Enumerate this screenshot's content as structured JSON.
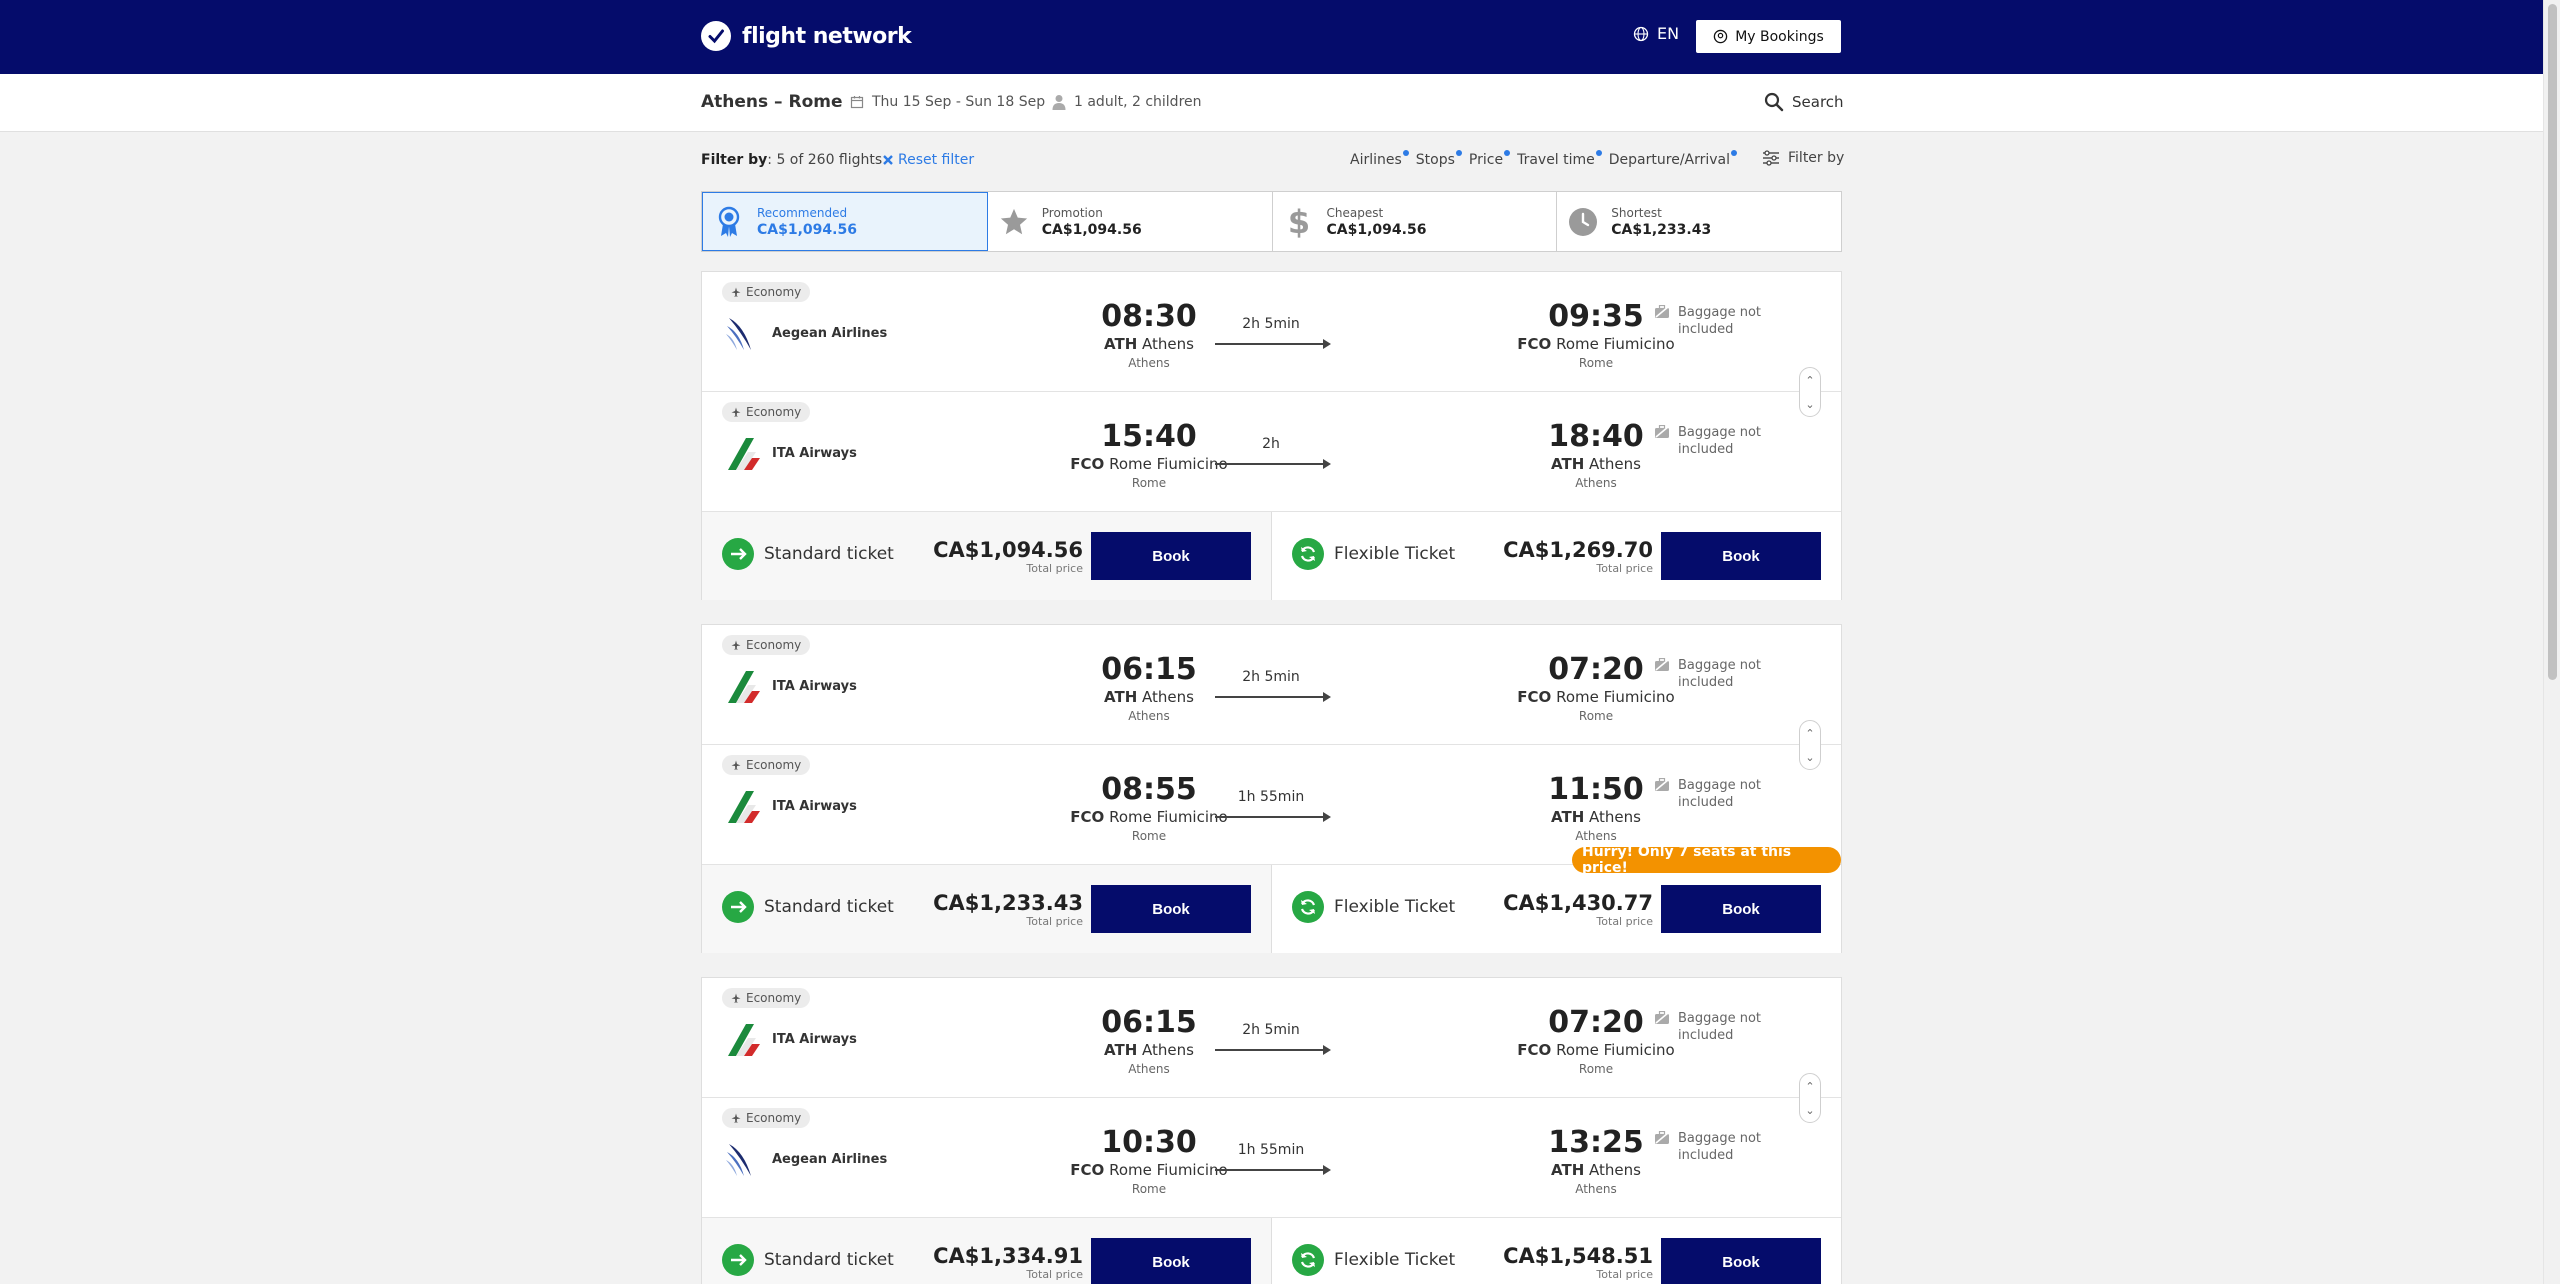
{
  "header": {
    "brand": "flight network",
    "language": "EN",
    "my_bookings": "My Bookings"
  },
  "summary": {
    "route": "Athens – Rome",
    "dates": "Thu 15 Sep - Sun 18 Sep",
    "passengers": "1 adult, 2 children",
    "search": "Search"
  },
  "filters": {
    "label": "Filter by",
    "count": ": 5 of 260 flights",
    "reset": "Reset filter",
    "chips": [
      "Airlines",
      "Stops",
      "Price",
      "Travel time",
      "Departure/Arrival"
    ],
    "filter_by": "Filter by"
  },
  "sort_tabs": [
    {
      "label": "Recommended",
      "price": "CA$1,094.56",
      "icon": "award-icon",
      "active": true
    },
    {
      "label": "Promotion",
      "price": "CA$1,094.56",
      "icon": "star-icon",
      "active": false
    },
    {
      "label": "Cheapest",
      "price": "CA$1,094.56",
      "icon": "dollar-icon",
      "active": false
    },
    {
      "label": "Shortest",
      "price": "CA$1,233.43",
      "icon": "clock-icon",
      "active": false
    }
  ],
  "results": [
    {
      "legs": [
        {
          "cabin": "Economy",
          "airline": "Aegean Airlines",
          "dep_time": "08:30",
          "dep_code": "ATH",
          "dep_airport": "Athens",
          "dep_city": "Athens",
          "duration": "2h 5min",
          "arr_time": "09:35",
          "arr_code": "FCO",
          "arr_airport": "Rome Fiumicino",
          "arr_city": "Rome",
          "baggage": "Baggage not included"
        },
        {
          "cabin": "Economy",
          "airline": "ITA Airways",
          "dep_time": "15:40",
          "dep_code": "FCO",
          "dep_airport": "Rome Fiumicino",
          "dep_city": "Rome",
          "duration": "2h",
          "arr_time": "18:40",
          "arr_code": "ATH",
          "arr_airport": "Athens",
          "arr_city": "Athens",
          "baggage": "Baggage not included"
        }
      ],
      "standard": {
        "name": "Standard ticket",
        "price": "CA$1,094.56",
        "sub": "Total price",
        "book": "Book"
      },
      "flexible": {
        "name": "Flexible Ticket",
        "price": "CA$1,269.70",
        "sub": "Total price",
        "book": "Book"
      }
    },
    {
      "legs": [
        {
          "cabin": "Economy",
          "airline": "ITA Airways",
          "dep_time": "06:15",
          "dep_code": "ATH",
          "dep_airport": "Athens",
          "dep_city": "Athens",
          "duration": "2h 5min",
          "arr_time": "07:20",
          "arr_code": "FCO",
          "arr_airport": "Rome Fiumicino",
          "arr_city": "Rome",
          "baggage": "Baggage not included"
        },
        {
          "cabin": "Economy",
          "airline": "ITA Airways",
          "dep_time": "08:55",
          "dep_code": "FCO",
          "dep_airport": "Rome Fiumicino",
          "dep_city": "Rome",
          "duration": "1h 55min",
          "arr_time": "11:50",
          "arr_code": "ATH",
          "arr_airport": "Athens",
          "arr_city": "Athens",
          "baggage": "Baggage not included"
        }
      ],
      "urgency": "Hurry! Only 7 seats at this price!",
      "standard": {
        "name": "Standard ticket",
        "price": "CA$1,233.43",
        "sub": "Total price",
        "book": "Book"
      },
      "flexible": {
        "name": "Flexible Ticket",
        "price": "CA$1,430.77",
        "sub": "Total price",
        "book": "Book"
      }
    },
    {
      "legs": [
        {
          "cabin": "Economy",
          "airline": "ITA Airways",
          "dep_time": "06:15",
          "dep_code": "ATH",
          "dep_airport": "Athens",
          "dep_city": "Athens",
          "duration": "2h 5min",
          "arr_time": "07:20",
          "arr_code": "FCO",
          "arr_airport": "Rome Fiumicino",
          "arr_city": "Rome",
          "baggage": "Baggage not included"
        },
        {
          "cabin": "Economy",
          "airline": "Aegean Airlines",
          "dep_time": "10:30",
          "dep_code": "FCO",
          "dep_airport": "Rome Fiumicino",
          "dep_city": "Rome",
          "duration": "1h 55min",
          "arr_time": "13:25",
          "arr_code": "ATH",
          "arr_airport": "Athens",
          "arr_city": "Athens",
          "baggage": "Baggage not included"
        }
      ],
      "standard": {
        "name": "Standard ticket",
        "price": "CA$1,334.91",
        "sub": "Total price",
        "book": "Book"
      },
      "flexible": {
        "name": "Flexible Ticket",
        "price": "CA$1,548.51",
        "sub": "Total price",
        "book": "Book"
      }
    }
  ],
  "colors": {
    "brand": "#050c6b",
    "accent": "#2d7be5",
    "fare_icon": "#27a844",
    "urgency": "#f39200"
  }
}
